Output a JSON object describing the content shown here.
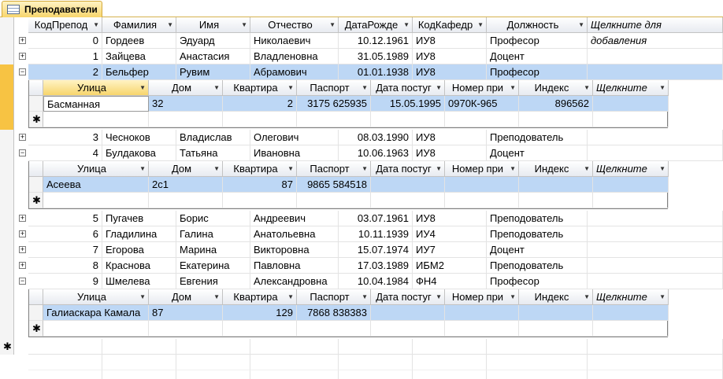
{
  "tab": {
    "title": "Преподаватели",
    "icon": "table-icon"
  },
  "columns": [
    "КодПрепод",
    "Фамилия",
    "Имя",
    "Отчество",
    "ДатаРожде",
    "КодКафедр",
    "Должность",
    "Щелкните для добавления"
  ],
  "sub_columns": [
    "Улица",
    "Дом",
    "Квартира",
    "Паспорт",
    "Дата постуг",
    "Номер при",
    "Индекс",
    "Щелкните"
  ],
  "rows": [
    {
      "id": "0",
      "fam": "Гордеев",
      "name": "Эдуард",
      "otch": "Николаевич",
      "date": "10.12.1961",
      "kaf": "ИУ8",
      "pos": "Професор",
      "expanded": false
    },
    {
      "id": "1",
      "fam": "Зайцева",
      "name": "Анастасия",
      "otch": "Владленовна",
      "date": "31.05.1989",
      "kaf": "ИУ8",
      "pos": "Доцент",
      "expanded": false
    },
    {
      "id": "2",
      "fam": "Бельфер",
      "name": "Рувим",
      "otch": "Абрамович",
      "date": "01.01.1938",
      "kaf": "ИУ8",
      "pos": "Професор",
      "expanded": true,
      "sub": {
        "street": "Басманная",
        "house": "32",
        "flat": "2",
        "passport": "3175 625935",
        "date": "15.05.1995",
        "order": "0970К-965",
        "index": "896562"
      }
    },
    {
      "id": "3",
      "fam": "Чесноков",
      "name": "Владислав",
      "otch": "Олегович",
      "date": "08.03.1990",
      "kaf": "ИУ8",
      "pos": "Преподователь",
      "expanded": false
    },
    {
      "id": "4",
      "fam": "Булдакова",
      "name": "Татьяна",
      "otch": "Ивановна",
      "date": "10.06.1963",
      "kaf": "ИУ8",
      "pos": "Доцент",
      "expanded": true,
      "sub": {
        "street": "Асеева",
        "house": "2с1",
        "flat": "87",
        "passport": "9865 584518",
        "date": "",
        "order": "",
        "index": ""
      }
    },
    {
      "id": "5",
      "fam": "Пугачев",
      "name": "Борис",
      "otch": "Андреевич",
      "date": "03.07.1961",
      "kaf": "ИУ8",
      "pos": "Преподователь",
      "expanded": false
    },
    {
      "id": "6",
      "fam": "Гладилина",
      "name": "Галина",
      "otch": "Анатольевна",
      "date": "10.11.1939",
      "kaf": "ИУ4",
      "pos": "Преподователь",
      "expanded": false
    },
    {
      "id": "7",
      "fam": "Егорова",
      "name": "Марина",
      "otch": "Викторовна",
      "date": "15.07.1974",
      "kaf": "ИУ7",
      "pos": "Доцент",
      "expanded": false
    },
    {
      "id": "8",
      "fam": "Краснова",
      "name": "Екатерина",
      "otch": "Павловна",
      "date": "17.03.1989",
      "kaf": "ИБМ2",
      "pos": "Преподователь",
      "expanded": false
    },
    {
      "id": "9",
      "fam": "Шмелева",
      "name": "Евгения",
      "otch": "Александровна",
      "date": "10.04.1984",
      "kaf": "ФН4",
      "pos": "Професор",
      "expanded": true,
      "sub": {
        "street": "Галиаскара Камала",
        "house": "87",
        "flat": "129",
        "passport": "7868 838383",
        "date": "",
        "order": "",
        "index": ""
      }
    }
  ],
  "new_row_marker": "✱",
  "colors": {
    "tab_accent": "#f7d56c",
    "row_highlight": "#bdd7f5",
    "selector_active": "#f7c343"
  }
}
